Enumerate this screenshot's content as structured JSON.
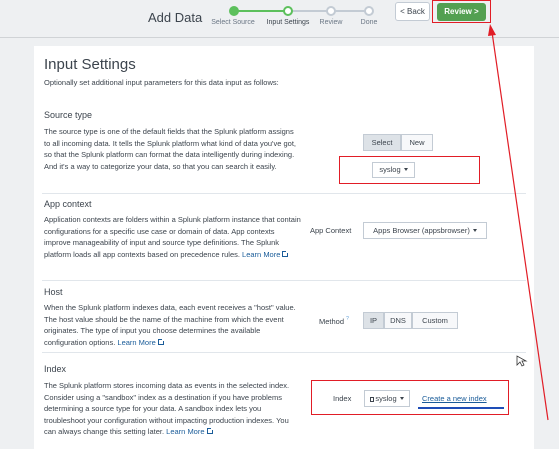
{
  "header": {
    "title": "Add Data",
    "back_label": "< Back",
    "review_label": "Review >",
    "steps": [
      {
        "label": "Select Source",
        "state": "done"
      },
      {
        "label": "Input Settings",
        "state": "current"
      },
      {
        "label": "Review",
        "state": "pending"
      },
      {
        "label": "Done",
        "state": "pending"
      }
    ]
  },
  "panel": {
    "title": "Input Settings",
    "subtitle": "Optionally set additional input parameters for this data input as follows:"
  },
  "source_type": {
    "title": "Source type",
    "text": "The source type is one of the default fields that the Splunk platform assigns to all incoming data. It tells the Splunk platform what kind of data you've got, so that the Splunk platform can format the data intelligently during indexing. And it's a way to categorize your data, so that you can search it easily.",
    "select_label": "Select",
    "new_label": "New",
    "dropdown_value": "syslog"
  },
  "app_context": {
    "title": "App context",
    "text": "Application contexts are folders within a Splunk platform instance that contain configurations for a specific use case or domain of data. App contexts improve manageability of input and source type definitions. The Splunk platform loads all app contexts based on precedence rules.",
    "learn_more": "Learn More",
    "field_label": "App Context",
    "dropdown_value": "Apps Browser (appsbrowser)"
  },
  "host": {
    "title": "Host",
    "text": "When the Splunk platform indexes data, each event receives a \"host\" value. The host value should be the name of the machine from which the event originates. The type of input you choose determines the available configuration options.",
    "learn_more": "Learn More",
    "field_label": "Method",
    "help": "?",
    "options": [
      "IP",
      "DNS",
      "Custom"
    ],
    "selected": "IP"
  },
  "index": {
    "title": "Index",
    "text": "The Splunk platform stores incoming data as events in the selected index. Consider using a \"sandbox\" index as a destination if you have problems determining a source type for your data. A sandbox index lets you troubleshoot your configuration without impacting production indexes. You can always change this setting later.",
    "learn_more": "Learn More",
    "field_label": "Index",
    "dropdown_value": "syslog",
    "create_link": "Create a new index"
  },
  "colors": {
    "accent_green": "#53a051",
    "annotation_red": "#e11d26",
    "link_blue": "#1a5c99"
  }
}
